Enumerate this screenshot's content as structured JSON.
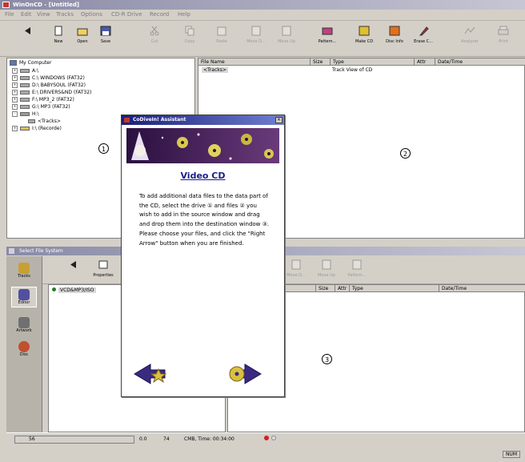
{
  "window": {
    "title": "WinOnCD - [Untitled]"
  },
  "menu": [
    "File",
    "Edit",
    "View",
    "Tracks",
    "Options",
    "CD-R Drive",
    "Record",
    "Help"
  ],
  "toolbar": {
    "new": "New",
    "open": "Open",
    "save": "Save",
    "cut": "Cut",
    "copy": "Copy",
    "paste": "Paste",
    "move_down": "Move D...",
    "move_up": "Move Up",
    "pattern": "Pattern...",
    "make_cd": "Make CD",
    "disc_info": "Disc Info",
    "erase_cd": "Erase C...",
    "analyzer": "Analyzer",
    "print": "Print"
  },
  "tree": {
    "root": "My Computer",
    "items": [
      "A:\\",
      "C:\\ WINDOWS (FAT32)",
      "D:\\ BABYSOUL (FAT32)",
      "E:\\ DRIVERS&ND (FAT32)",
      "F:\\ MP3_2 (FAT32)",
      "G:\\ MP3 (FAT32)",
      "H:\\",
      "<Tracks>",
      "I:\\ (Recorde)"
    ]
  },
  "file_pane": {
    "columns": [
      "File Name",
      "Size",
      "Type",
      "Attr",
      "Date/Time"
    ],
    "rows": [
      {
        "name": "<Tracks>",
        "size": "",
        "type": "Track View of CD",
        "attr": "",
        "date": ""
      }
    ]
  },
  "markers": [
    "1",
    "2",
    "3"
  ],
  "bottom_panel": {
    "title": "Select File System",
    "side_buttons": [
      "Tracks",
      "Editor",
      "Artwork",
      "Disc"
    ],
    "properties": "Properties",
    "tree_item": "VCD&MP3/ISO",
    "tool_labels": [
      "Move D...",
      "Move Up",
      "Pattern..."
    ],
    "columns": [
      "Size",
      "Attr",
      "Type",
      "Date/Time"
    ]
  },
  "status": {
    "left": "56",
    "mid1": "0.0",
    "mid2": "74",
    "cdtime": "CMB, Time: 00:34:00",
    "right": "NUM"
  },
  "dialog": {
    "title": "CoDiveIn! Assistant",
    "heading": "Video CD",
    "body": "To add additional data files to the data part of the CD, select the drive ① and files ② you wish to add in the source window and drag and drop them into the destination window ③. Please choose your files, and click the \"Right Arrow\" button when you are finished."
  }
}
